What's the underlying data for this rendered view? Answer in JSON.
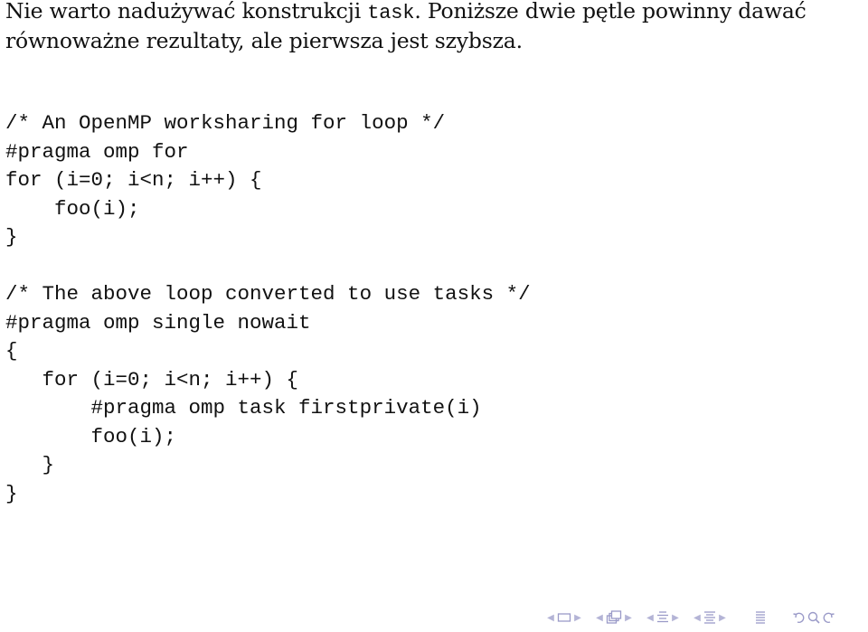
{
  "intro": {
    "part1": "Nie warto nadużywać konstrukcji ",
    "code_word": "task",
    "part2": ". Poniższe dwie pętle powinny dawać równoważne rezultaty, ale pierwsza jest szybsza."
  },
  "code_blocks": [
    {
      "lines": [
        "/* An OpenMP worksharing for loop */",
        "#pragma omp for",
        "for (i=0; i<n; i++) {",
        "    foo(i);",
        "}"
      ]
    },
    {
      "lines": [
        "/* The above loop converted to use tasks */",
        "#pragma omp single nowait",
        "{",
        "   for (i=0; i<n; i++) {",
        "       #pragma omp task firstprivate(i)",
        "       foo(i);",
        "   }",
        "}"
      ]
    }
  ],
  "navigation": {
    "icons": [
      "prev-frame-icon",
      "frame-icon",
      "next-frame-icon",
      "prev-slide-icon",
      "slide-icon",
      "next-slide-icon",
      "prev-section-icon",
      "section-icon",
      "next-section-icon",
      "prev-subsection-icon",
      "subsection-icon",
      "next-subsection-icon",
      "document-icon",
      "back-icon",
      "search-icon",
      "forward-icon"
    ],
    "color": "#9a9ac8"
  }
}
